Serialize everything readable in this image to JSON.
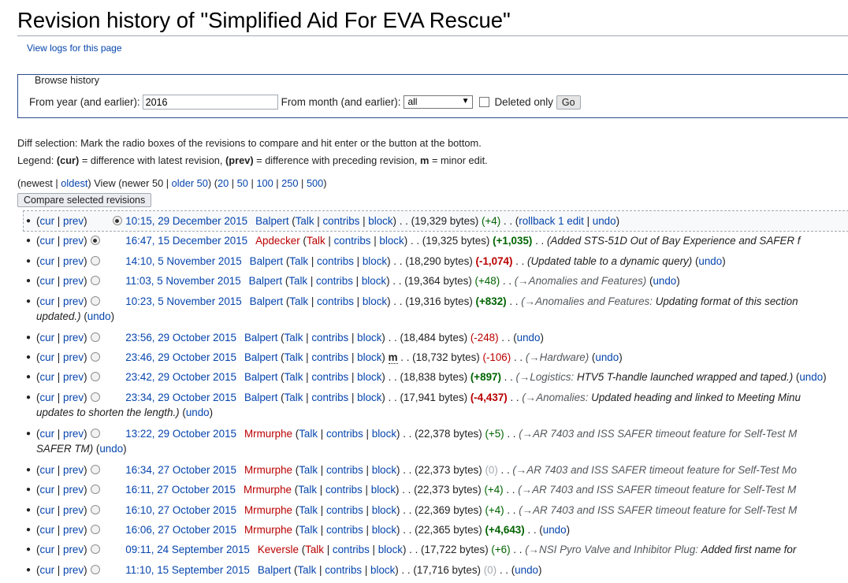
{
  "page": {
    "title": "Revision history of \"Simplified Aid For EVA Rescue\"",
    "view_logs": "View logs for this page"
  },
  "browse": {
    "legend": "Browse history",
    "year_label": "From year (and earlier):",
    "year_value": "2016",
    "month_label": "From month (and earlier):",
    "month_value": "all",
    "deleted_label": "Deleted only",
    "go_label": "Go"
  },
  "info": {
    "diff_selection": "Diff selection: Mark the radio boxes of the revisions to compare and hit enter or the button at the bottom.",
    "legend_prefix": "Legend: ",
    "legend_cur": "(cur)",
    "legend_cur_desc": " = difference with latest revision, ",
    "legend_prev": "(prev)",
    "legend_prev_desc": " = difference with preceding revision, ",
    "legend_m": "m",
    "legend_m_desc": " = minor edit."
  },
  "nav": {
    "newest": "newest",
    "oldest": "oldest",
    "view_text": "View (newer 50 |",
    "older": "older 50",
    "n20": "20",
    "n50": "50",
    "n100": "100",
    "n250": "250",
    "n500": "500"
  },
  "compare_button": "Compare selected revisions",
  "common": {
    "cur": "cur",
    "prev": "prev",
    "talk": "Talk",
    "contribs": "contribs",
    "block": "block",
    "undo": "undo"
  },
  "revisions": [
    {
      "date": "10:15, 29 December 2015",
      "user": "Balpert",
      "bytes": "(19,329 bytes)",
      "diff": "(+4)",
      "tail": "rollback 1 edit"
    },
    {
      "date": "16:47, 15 December 2015",
      "user": "Apdecker",
      "bytes": "(19,325 bytes)",
      "diff": "(+1,035)",
      "comment": "(Added STS-51D Out of Bay Experience and SAFER f"
    },
    {
      "date": "14:10, 5 November 2015",
      "user": "Balpert",
      "bytes": "(18,290 bytes)",
      "diff": "(-1,074)",
      "comment": "(Updated table to a dynamic query)"
    },
    {
      "date": "11:03, 5 November 2015",
      "user": "Balpert",
      "bytes": "(19,364 bytes)",
      "diff": "(+48)",
      "section": "(→Anomalies and Features)"
    },
    {
      "date": "10:23, 5 November 2015",
      "user": "Balpert",
      "bytes": "(19,316 bytes)",
      "diff": "(+832)",
      "section": "(→Anomalies and Features:",
      "comment": "Updating format of this section",
      "comment2": "updated.)"
    },
    {
      "date": "23:56, 29 October 2015",
      "user": "Balpert",
      "bytes": "(18,484 bytes)",
      "diff": "(-248)"
    },
    {
      "date": "23:46, 29 October 2015",
      "user": "Balpert",
      "minor": "m",
      "bytes": "(18,732 bytes)",
      "diff": "(-106)",
      "section": "(→Hardware)"
    },
    {
      "date": "23:42, 29 October 2015",
      "user": "Balpert",
      "bytes": "(18,838 bytes)",
      "diff": "(+897)",
      "section": "(→Logistics:",
      "comment": "HTV5 T-handle launched wrapped and taped.)"
    },
    {
      "date": "23:34, 29 October 2015",
      "user": "Balpert",
      "bytes": "(17,941 bytes)",
      "diff": "(-4,437)",
      "section": "(→Anomalies:",
      "comment": "Updated heading and linked to Meeting Minu",
      "comment2": "updates to shorten the length.)"
    },
    {
      "date": "13:22, 29 October 2015",
      "user": "Mrmurphe",
      "bytes": "(22,378 bytes)",
      "diff": "(+5)",
      "section": "(→AR 7403 and ISS SAFER timeout feature for Self-Test M",
      "comment2": "SAFER TM)"
    },
    {
      "date": "16:34, 27 October 2015",
      "user": "Mrmurphe",
      "bytes": "(22,373 bytes)",
      "diff": "(0)",
      "section": "(→AR 7403 and ISS SAFER timeout feature for Self-Test Mo"
    },
    {
      "date": "16:11, 27 October 2015",
      "user": "Mrmurphe",
      "bytes": "(22,373 bytes)",
      "diff": "(+4)",
      "section": "(→AR 7403 and ISS SAFER timeout feature for Self-Test M"
    },
    {
      "date": "16:10, 27 October 2015",
      "user": "Mrmurphe",
      "bytes": "(22,369 bytes)",
      "diff": "(+4)",
      "section": "(→AR 7403 and ISS SAFER timeout feature for Self-Test M"
    },
    {
      "date": "16:06, 27 October 2015",
      "user": "Mrmurphe",
      "bytes": "(22,365 bytes)",
      "diff": "(+4,643)"
    },
    {
      "date": "09:11, 24 September 2015",
      "user": "Keversle",
      "bytes": "(17,722 bytes)",
      "diff": "(+6)",
      "section": "(→NSI Pyro Valve and Inhibitor Plug:",
      "comment": "Added first name for"
    },
    {
      "date": "11:10, 15 September 2015",
      "user": "Balpert",
      "bytes": "(17,716 bytes)",
      "diff": "(0)"
    }
  ]
}
